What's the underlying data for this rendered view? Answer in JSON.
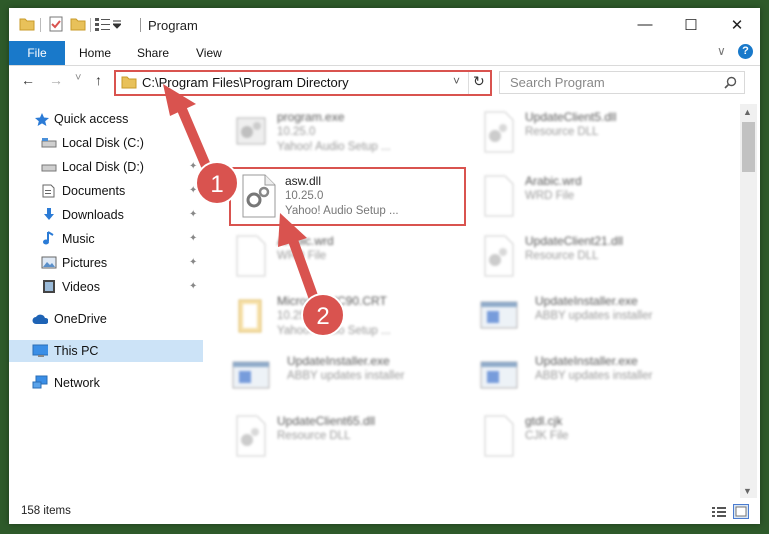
{
  "window": {
    "title": "Program",
    "controls": {
      "minimize": "—",
      "maximize": "☐",
      "close": "✕"
    }
  },
  "ribbon": {
    "tabs": [
      "File",
      "Home",
      "Share",
      "View"
    ],
    "help": "?",
    "expand": "∨"
  },
  "nav": {
    "back": "←",
    "forward": "→",
    "recent": "˅",
    "up": "↑",
    "address": "C:\\Program Files\\Program Directory",
    "address_dropdown": "˅",
    "refresh": "↻",
    "search_placeholder": "Search Program",
    "search_icon": "search-icon"
  },
  "sidebar": {
    "items": [
      {
        "label": "Quick access",
        "icon": "star-icon",
        "pinned": false
      },
      {
        "label": "Local Disk (C:)",
        "icon": "drive-icon",
        "pinned": true
      },
      {
        "label": "Local Disk (D:)",
        "icon": "drive-icon",
        "pinned": true
      },
      {
        "label": "Documents",
        "icon": "documents-icon",
        "pinned": true
      },
      {
        "label": "Downloads",
        "icon": "download-icon",
        "pinned": true
      },
      {
        "label": "Music",
        "icon": "music-icon",
        "pinned": true
      },
      {
        "label": "Pictures",
        "icon": "pictures-icon",
        "pinned": true
      },
      {
        "label": "Videos",
        "icon": "videos-icon",
        "pinned": true
      },
      {
        "label": "OneDrive",
        "icon": "cloud-icon",
        "pinned": false
      },
      {
        "label": "This PC",
        "icon": "computer-icon",
        "pinned": false,
        "selected": true
      },
      {
        "label": "Network",
        "icon": "network-icon",
        "pinned": false
      }
    ],
    "pin_glyph": "✦"
  },
  "files": [
    {
      "name": "program.exe",
      "line1": "10.25.0",
      "line2": "Yahoo! Audio Setup ...",
      "icon": "exe-gear-icon"
    },
    {
      "name": "UpdateClient5.dll",
      "line1": "Resource DLL",
      "line2": "",
      "icon": "dll-gear-icon"
    },
    {
      "name": "asw.dll",
      "line1": "10.25.0",
      "line2": "Yahoo! Audio Setup ...",
      "icon": "dll-gear-icon",
      "highlighted": true
    },
    {
      "name": "Arabic.wrd",
      "line1": "WRD File",
      "line2": "",
      "icon": "blank-file-icon"
    },
    {
      "name": "Arabic.wrd",
      "line1": "WRD File",
      "line2": "",
      "icon": "blank-file-icon"
    },
    {
      "name": "UpdateClient21.dll",
      "line1": "Resource DLL",
      "line2": "",
      "icon": "dll-gear-icon"
    },
    {
      "name": "Microsoft.VC90.CRT",
      "line1": "10.25.0",
      "line2": "Yahoo! Audio Setup ...",
      "icon": "folder-icon"
    },
    {
      "name": "UpdateInstaller.exe",
      "line1": "ABBY updates installer",
      "line2": "",
      "icon": "installer-icon"
    },
    {
      "name": "UpdateInstaller.exe",
      "line1": "ABBY updates installer",
      "line2": "",
      "icon": "installer-icon"
    },
    {
      "name": "UpdateInstaller.exe",
      "line1": "ABBY updates installer",
      "line2": "",
      "icon": "installer-icon"
    },
    {
      "name": "UpdateClient65.dll",
      "line1": "Resource DLL",
      "line2": "",
      "icon": "dll-gear-icon"
    },
    {
      "name": "gtdl.cjk",
      "line1": "CJK File",
      "line2": "",
      "icon": "blank-file-icon"
    }
  ],
  "status": {
    "count": "158 items"
  },
  "annotations": {
    "step1": "1",
    "step2": "2"
  },
  "colors": {
    "accent": "#1979ca",
    "highlight": "#d9534f",
    "selected": "#cce3f7"
  }
}
